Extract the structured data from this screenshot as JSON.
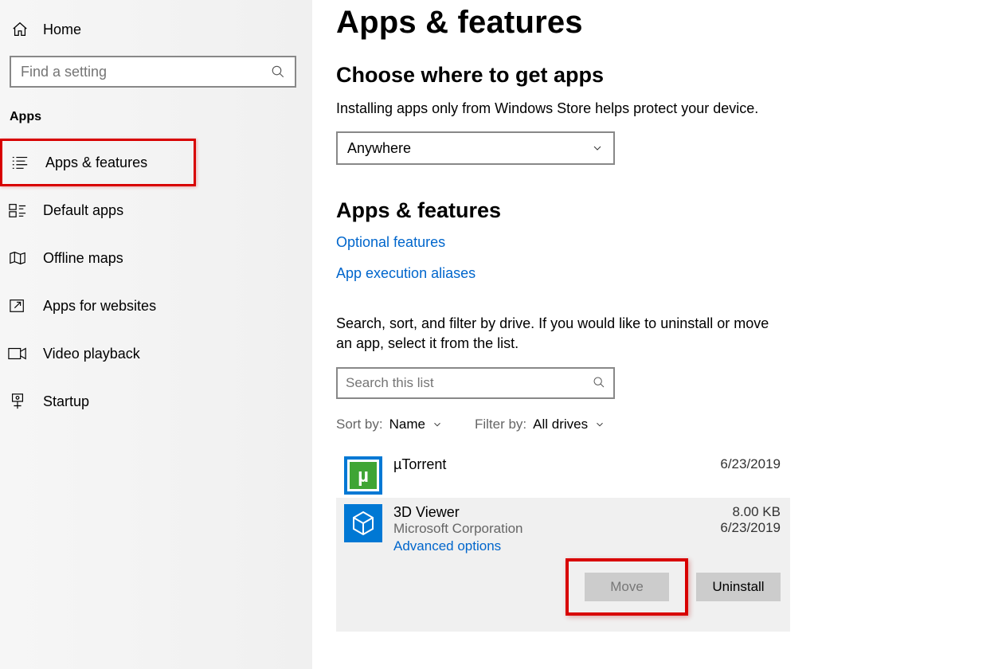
{
  "sidebar": {
    "home_label": "Home",
    "search_placeholder": "Find a setting",
    "section_label": "Apps",
    "items": [
      {
        "label": "Apps & features"
      },
      {
        "label": "Default apps"
      },
      {
        "label": "Offline maps"
      },
      {
        "label": "Apps for websites"
      },
      {
        "label": "Video playback"
      },
      {
        "label": "Startup"
      }
    ]
  },
  "main": {
    "page_title": "Apps & features",
    "choose_heading": "Choose where to get apps",
    "choose_desc": "Installing apps only from Windows Store helps protect your device.",
    "source_select_value": "Anywhere",
    "apps_heading": "Apps & features",
    "links": {
      "optional": "Optional features",
      "aliases": "App execution aliases"
    },
    "filter_desc": "Search, sort, and filter by drive. If you would like to uninstall or move an app, select it from the list.",
    "search_list_placeholder": "Search this list",
    "sort": {
      "label": "Sort by:",
      "value": "Name"
    },
    "filter": {
      "label": "Filter by:",
      "value": "All drives"
    },
    "apps": [
      {
        "name": "µTorrent",
        "date": "6/23/2019"
      },
      {
        "name": "3D Viewer",
        "publisher": "Microsoft Corporation",
        "size": "8.00 KB",
        "date": "6/23/2019",
        "adv": "Advanced options"
      }
    ],
    "buttons": {
      "move": "Move",
      "uninstall": "Uninstall"
    }
  }
}
